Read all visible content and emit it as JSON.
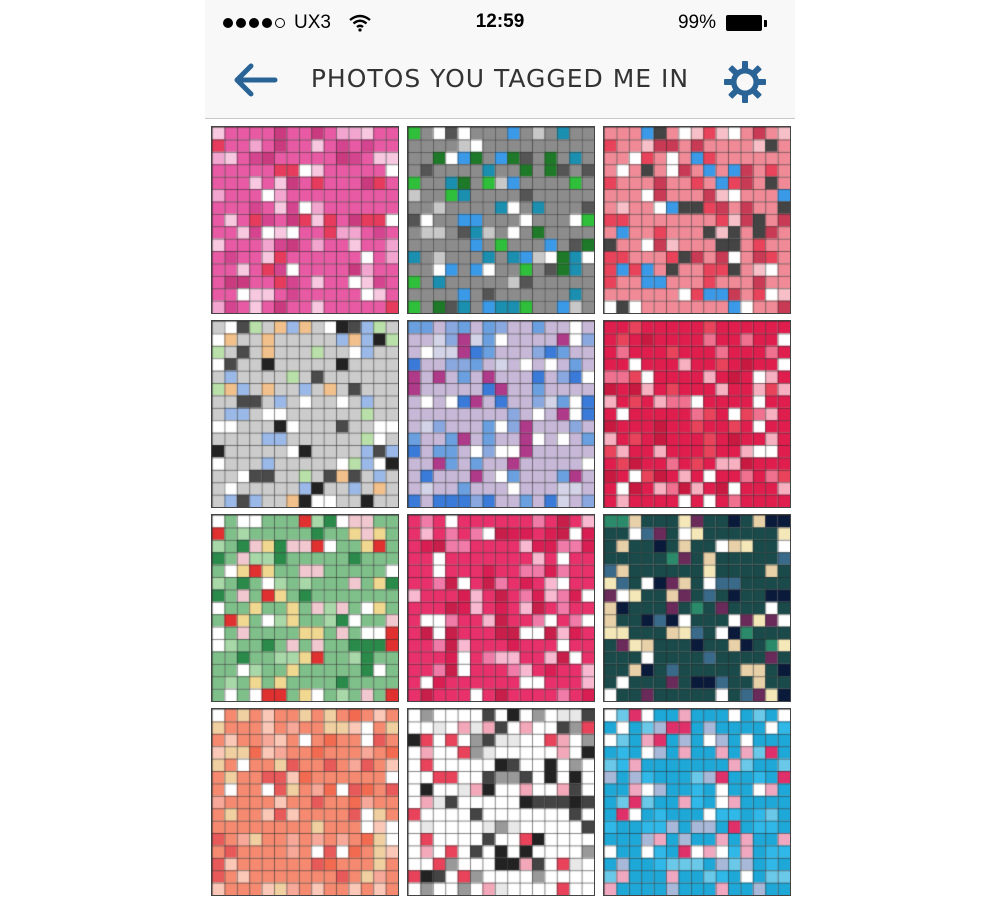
{
  "status_bar": {
    "carrier": "UX3",
    "time": "12:59",
    "battery": "99%",
    "signal_bars": 4
  },
  "nav": {
    "title": "PHOTOS  YOU TAGGED ME IN",
    "back_icon": "arrow-left-icon",
    "settings_icon": "gear-icon",
    "accent_color": "#2a6496"
  },
  "photos": [
    {
      "palette": [
        "#e85aa4",
        "#f2a6cf",
        "#d4448f",
        "#f7c8e0",
        "#c93a7e",
        "#ffffff",
        "#e63b5c"
      ],
      "dominant": "pink"
    },
    {
      "palette": [
        "#8c8c8c",
        "#2fbf3a",
        "#3a9ae8",
        "#1e7a28",
        "#c8c8c8",
        "#1a8fb0",
        "#555555",
        "#ffffff"
      ],
      "dominant": "green-blue"
    },
    {
      "palette": [
        "#f08a96",
        "#e8435a",
        "#f7c0c8",
        "#ffffff",
        "#3a9ae8",
        "#444444",
        "#c93a55"
      ],
      "dominant": "rose"
    },
    {
      "palette": [
        "#cccccc",
        "#4a4a4a",
        "#ffffff",
        "#222222",
        "#9ab8e8",
        "#f2c08a",
        "#b8e0a8"
      ],
      "dominant": "gray"
    },
    {
      "palette": [
        "#c7b8d8",
        "#6aa0e0",
        "#8aa8e0",
        "#d4d4e8",
        "#b03a8a",
        "#3a7ad8",
        "#ffffff"
      ],
      "dominant": "lavender"
    },
    {
      "palette": [
        "#e01e4e",
        "#c81940",
        "#f07090",
        "#f7b0c0",
        "#ffffff",
        "#e8435a"
      ],
      "dominant": "crimson"
    },
    {
      "palette": [
        "#7fc08a",
        "#2a8a4a",
        "#e03030",
        "#f2c8d0",
        "#ffffff",
        "#a8d8a8",
        "#f0d890"
      ],
      "dominant": "green-red"
    },
    {
      "palette": [
        "#e8306a",
        "#f07aa8",
        "#d81e52",
        "#f7b8d0",
        "#ffffff",
        "#c81e4a"
      ],
      "dominant": "magenta"
    },
    {
      "palette": [
        "#1a4a4a",
        "#0a1a3a",
        "#e8d0a8",
        "#2a8a6a",
        "#f5e8b8",
        "#6a2a5a",
        "#ffffff",
        "#3a6a8a"
      ],
      "dominant": "dark"
    },
    {
      "palette": [
        "#f58a70",
        "#f26a50",
        "#f7a898",
        "#fbc8b8",
        "#e85a5a",
        "#ffffff",
        "#f0d0a0"
      ],
      "dominant": "coral"
    },
    {
      "palette": [
        "#ffffff",
        "#e8e8e8",
        "#444444",
        "#f2a8b8",
        "#e8435a",
        "#999999",
        "#222222"
      ],
      "dominant": "mixed"
    },
    {
      "palette": [
        "#1ea8d8",
        "#2fb8e8",
        "#6ac8e8",
        "#a8b8d8",
        "#f0a8c0",
        "#e0306a",
        "#ffffff"
      ],
      "dominant": "cyan"
    }
  ]
}
